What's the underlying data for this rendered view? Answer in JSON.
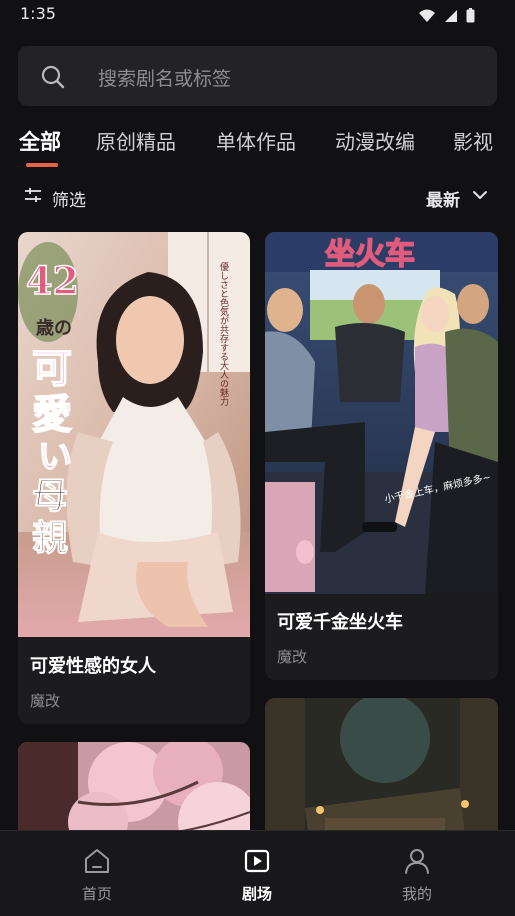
{
  "status_bar": {
    "time": "1:35"
  },
  "search": {
    "placeholder": "搜索剧名或标签"
  },
  "tabs": [
    {
      "label": "全部",
      "active": true
    },
    {
      "label": "原创精品",
      "active": false
    },
    {
      "label": "单体作品",
      "active": false
    },
    {
      "label": "动漫改编",
      "active": false
    },
    {
      "label": "影视",
      "active": false
    }
  ],
  "filter": {
    "label": "筛选",
    "sort_label": "最新"
  },
  "cards": [
    {
      "title": "可爱性感的女人",
      "tag": "魔改",
      "poster_text": {
        "age": "42",
        "suffix": "歳の",
        "big1": "可",
        "big2": "愛",
        "big3": "い",
        "main": "母親",
        "sub": "優しさと色気が共存する大人の魅力"
      }
    },
    {
      "title": "可爱千金坐火车",
      "tag": "魔改",
      "poster_text": {
        "banner": "坐火车",
        "caption": "小千金上车，麻烦多多~"
      }
    },
    {
      "title": "",
      "tag": ""
    },
    {
      "title": "",
      "tag": ""
    }
  ],
  "bottom_nav": [
    {
      "label": "首页",
      "icon": "home-icon",
      "active": false
    },
    {
      "label": "剧场",
      "icon": "play-icon",
      "active": true
    },
    {
      "label": "我的",
      "icon": "profile-icon",
      "active": false
    }
  ],
  "colors": {
    "accent": "#e8624a",
    "background": "#111113",
    "card": "#1c1c1f"
  }
}
